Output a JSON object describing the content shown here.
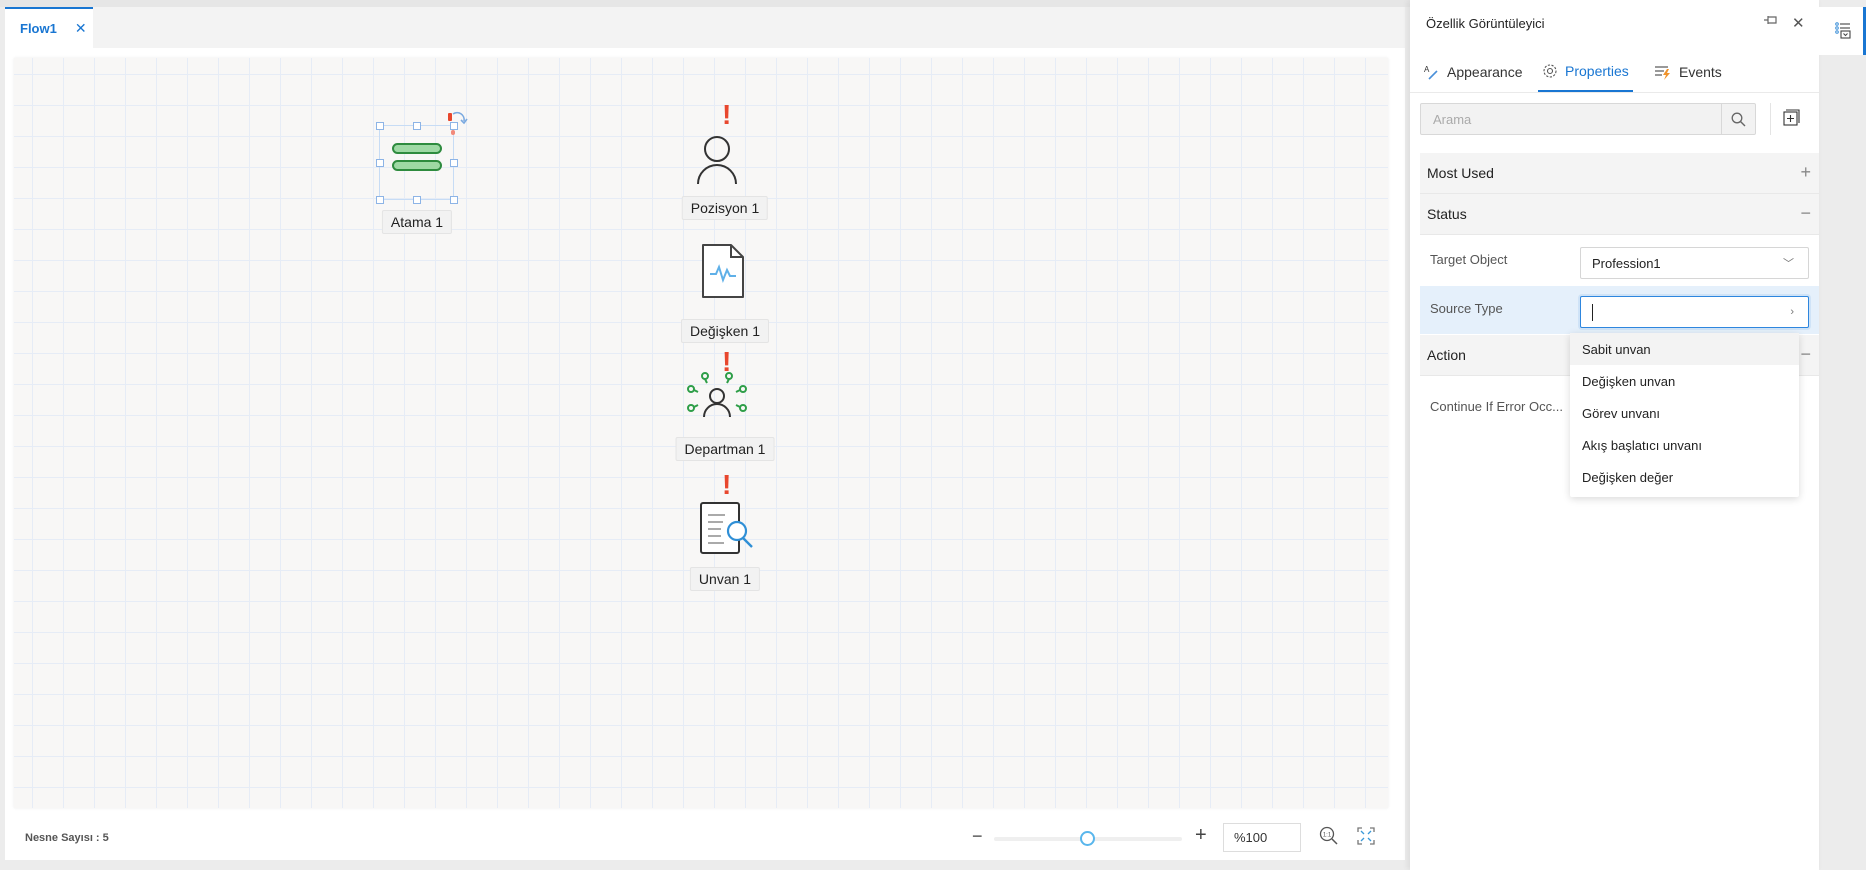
{
  "document_tabs": [
    {
      "label": "Flow1",
      "active": true,
      "close_icon": "close-icon"
    }
  ],
  "canvas": {
    "nodes": [
      {
        "id": "atama",
        "label": "Atama 1",
        "icon": "assignment-icon",
        "selected": true,
        "warning": true
      },
      {
        "id": "pozisyon",
        "label": "Pozisyon 1",
        "icon": "person-icon",
        "selected": false,
        "warning": true
      },
      {
        "id": "degisken",
        "label": "Değişken 1",
        "icon": "variable-document-icon",
        "selected": false,
        "warning": false
      },
      {
        "id": "departman",
        "label": "Departman 1",
        "icon": "department-icon",
        "selected": false,
        "warning": true
      },
      {
        "id": "unvan",
        "label": "Unvan 1",
        "icon": "title-search-icon",
        "selected": false,
        "warning": true
      }
    ],
    "warning_glyph": "!"
  },
  "footer": {
    "object_count_label": "Nesne Sayısı : 5",
    "zoom_minus": "−",
    "zoom_plus": "+",
    "zoom_value": "%100",
    "zoom_slider_percent": 50
  },
  "panel": {
    "title": "Özellik Görüntüleyici",
    "tabs": [
      {
        "label": "Appearance",
        "icon": "appearance-icon",
        "active": false
      },
      {
        "label": "Properties",
        "icon": "gear-icon",
        "active": true
      },
      {
        "label": "Events",
        "icon": "events-icon",
        "active": false
      }
    ],
    "search_placeholder": "Arama",
    "sections": [
      {
        "label": "Most Used",
        "toggle": "+",
        "expanded": false
      },
      {
        "label": "Status",
        "toggle": "−",
        "expanded": true
      },
      {
        "label": "Action",
        "toggle": "−",
        "expanded": true
      }
    ],
    "properties": [
      {
        "label": "Target Object",
        "value": "Profession1"
      },
      {
        "label": "Source Type",
        "value": ""
      },
      {
        "label": "Continue If Error Occ...",
        "value": ""
      }
    ],
    "source_type_options": [
      "Sabit unvan",
      "Değişken unvan",
      "Görev unvanı",
      "Akış başlatıcı unvanı",
      "Değişken değer"
    ]
  },
  "colors": {
    "accent": "#1976d2",
    "warning": "#e8472d",
    "node_green": "#2e9e48"
  }
}
